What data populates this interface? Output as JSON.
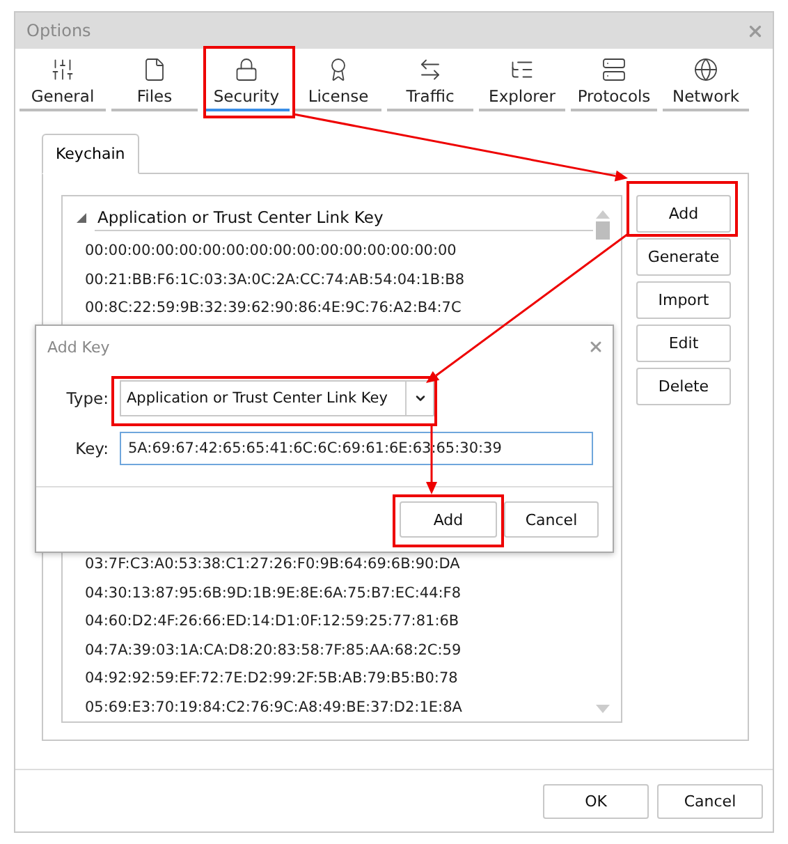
{
  "window": {
    "title": "Options"
  },
  "tabs": [
    {
      "label": "General",
      "selected": false
    },
    {
      "label": "Files",
      "selected": false
    },
    {
      "label": "Security",
      "selected": true
    },
    {
      "label": "License",
      "selected": false
    },
    {
      "label": "Traffic",
      "selected": false
    },
    {
      "label": "Explorer",
      "selected": false
    },
    {
      "label": "Protocols",
      "selected": false
    },
    {
      "label": "Network",
      "selected": false
    }
  ],
  "subtabs": [
    {
      "label": "Keychain",
      "selected": true
    }
  ],
  "keychain": {
    "group": {
      "label": "Application or Trust Center Link Key",
      "expanded": true
    },
    "keys_top": [
      "00:00:00:00:00:00:00:00:00:00:00:00:00:00:00:00",
      "00:21:BB:F6:1C:03:3A:0C:2A:CC:74:AB:54:04:1B:B8",
      "00:8C:22:59:9B:32:39:62:90:86:4E:9C:76:A2:B4:7C"
    ],
    "keys_bottom": [
      "03:7F:C3:A0:53:38:C1:27:26:F0:9B:64:69:6B:90:DA",
      "04:30:13:87:95:6B:9D:1B:9E:8E:6A:75:B7:EC:44:F8",
      "04:60:D2:4F:26:66:ED:14:D1:0F:12:59:25:77:81:6B",
      "04:7A:39:03:1A:CA:D8:20:83:58:7F:85:AA:68:2C:59",
      "04:92:92:59:EF:72:7E:D2:99:2F:5B:AB:79:B5:B0:78",
      "05:69:E3:70:19:84:C2:76:9C:A8:49:BE:37:D2:1E:8A"
    ]
  },
  "side_buttons": [
    "Add",
    "Generate",
    "Import",
    "Edit",
    "Delete"
  ],
  "dialog": {
    "title": "Add Key",
    "type_label": "Type:",
    "type_value": "Application or Trust Center Link Key",
    "key_label": "Key:",
    "key_value": "5A:69:67:42:65:65:41:6C:6C:69:61:6E:63:65:30:39",
    "buttons": [
      "Add",
      "Cancel"
    ]
  },
  "footer_buttons": [
    "OK",
    "Cancel"
  ]
}
